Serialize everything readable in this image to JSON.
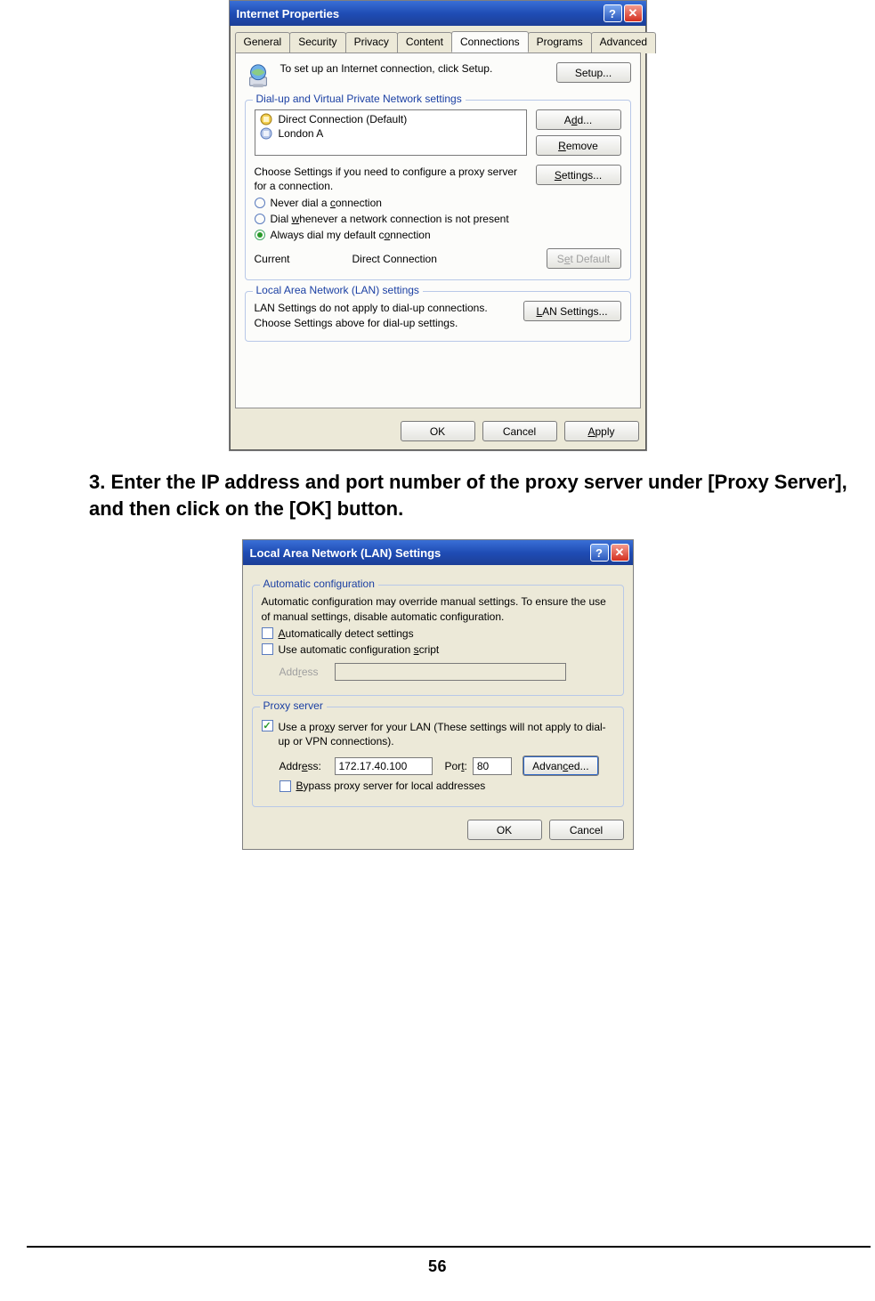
{
  "page": {
    "number": "56"
  },
  "instruction": "3. Enter the IP address and port number of the proxy server under [Proxy Server], and then click on the [OK] button.",
  "ip_dialog": {
    "title": "Internet Properties",
    "help_btn": "?",
    "close_btn": "✕",
    "tabs": {
      "general": "General",
      "security": "Security",
      "privacy": "Privacy",
      "content": "Content",
      "connections": "Connections",
      "programs": "Programs",
      "advanced": "Advanced"
    },
    "intro": "To set up an Internet connection, click Setup.",
    "setup_btn": "Setup...",
    "group_dialup_title": "Dial-up and Virtual Private Network settings",
    "conn_list": {
      "item1": "Direct Connection (Default)",
      "item2": "London A"
    },
    "add_btn": "Add...",
    "remove_btn": "Remove",
    "settings_help": "Choose Settings if you need to configure a proxy server for a connection.",
    "settings_btn": "Settings...",
    "radio_never": "Never dial a connection",
    "radio_whenever": "Dial whenever a network connection is not present",
    "radio_always": "Always dial my default connection",
    "current_label": "Current",
    "current_value": "Direct Connection",
    "set_default_btn": "Set Default",
    "group_lan_title": "Local Area Network (LAN) settings",
    "lan_help": "LAN Settings do not apply to dial-up connections. Choose Settings above for dial-up settings.",
    "lan_settings_btn": "LAN Settings...",
    "ok": "OK",
    "cancel": "Cancel",
    "apply": "Apply"
  },
  "lan_dialog": {
    "title": "Local Area Network (LAN) Settings",
    "help_btn": "?",
    "close_btn": "✕",
    "group_auto_title": "Automatic configuration",
    "auto_help": "Automatic configuration may override manual settings. To ensure the use of manual settings, disable automatic configuration.",
    "chk_auto_detect": "Automatically detect settings",
    "chk_auto_script": "Use automatic configuration script",
    "address_label": "Address",
    "group_proxy_title": "Proxy server",
    "chk_use_proxy": "Use a proxy server for your LAN (These settings will not apply to dial-up or VPN connections).",
    "addr_label": "Address:",
    "addr_value": "172.17.40.100",
    "port_label": "Port:",
    "port_value": "80",
    "advanced_btn": "Advanced...",
    "chk_bypass": "Bypass proxy server for local addresses",
    "ok": "OK",
    "cancel": "Cancel"
  }
}
